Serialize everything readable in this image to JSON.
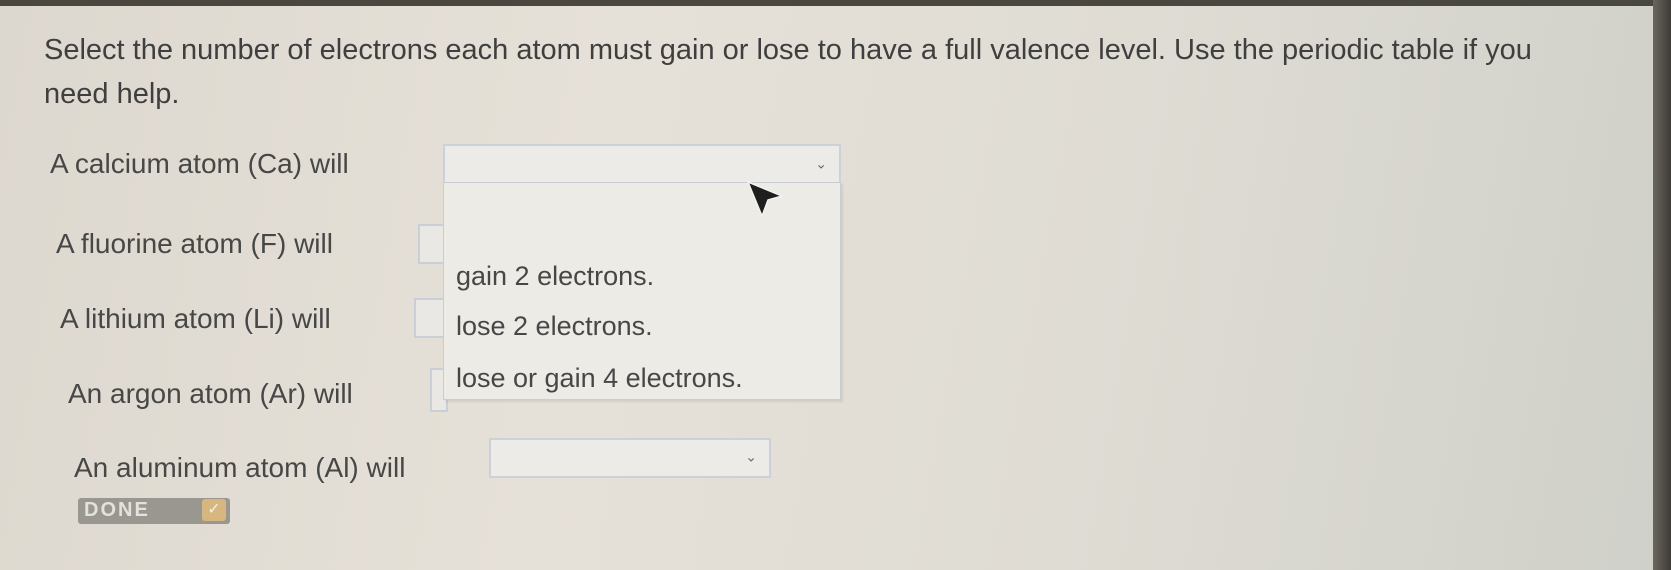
{
  "instructions": "Select the number of electrons each atom must gain or lose to have a full valence level. Use the periodic table if you need help.",
  "rows": [
    {
      "label": "A calcium atom (Ca) will"
    },
    {
      "label": "A fluorine atom (F) will"
    },
    {
      "label": "A lithium atom (Li) will"
    },
    {
      "label": "An argon atom (Ar) will"
    },
    {
      "label": "An aluminum atom (Al) will"
    }
  ],
  "dropdown": {
    "options": [
      "gain 2 electrons.",
      "lose 2 electrons.",
      "lose or gain 4 electrons."
    ]
  },
  "done_button": {
    "label": "DONE"
  },
  "icons": {
    "chevron": "chevron-down-icon",
    "cursor": "mouse-pointer-icon",
    "check": "check-icon"
  },
  "colors": {
    "button_bg": "#9a9690",
    "check_bg": "#d5b77f"
  }
}
